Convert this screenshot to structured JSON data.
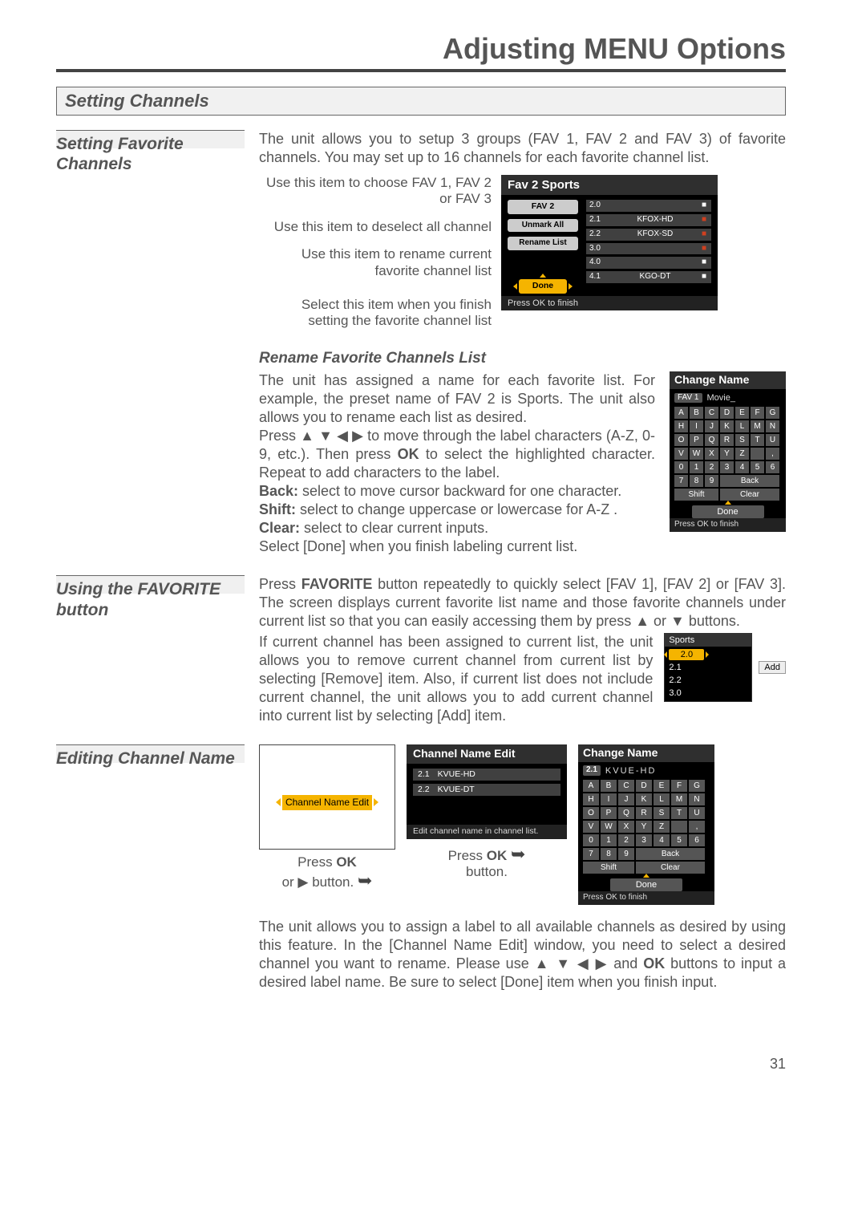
{
  "page": {
    "title": "Adjusting MENU Options",
    "number": "31"
  },
  "setting_channels": {
    "header": "Setting Channels"
  },
  "setting_favorite": {
    "side_label": "Setting Favorite Channels",
    "intro": "The unit allows you to setup 3 groups (FAV 1, FAV 2 and FAV 3) of favorite channels. You may set up to 16 channels for each favorite channel list.",
    "callouts": {
      "a": "Use this item to choose FAV 1, FAV 2 or FAV 3",
      "b": "Use this item to deselect all channel",
      "c": "Use this item to rename current favorite channel list",
      "d": "Select this item when you finish setting the favorite channel list"
    },
    "osd": {
      "title": "Fav 2 Sports",
      "buttons": {
        "fav2": "FAV 2",
        "unmark": "Unmark All",
        "rename": "Rename List",
        "done": "Done"
      },
      "channels": [
        {
          "ch": "2.0",
          "name": "",
          "flag": "■",
          "flag_red": false
        },
        {
          "ch": "2.1",
          "name": "KFOX-HD",
          "flag": "■",
          "flag_red": true
        },
        {
          "ch": "2.2",
          "name": "KFOX-SD",
          "flag": "■",
          "flag_red": true
        },
        {
          "ch": "3.0",
          "name": "",
          "flag": "■",
          "flag_red": true
        },
        {
          "ch": "4.0",
          "name": "",
          "flag": "■",
          "flag_red": false
        },
        {
          "ch": "4.1",
          "name": "KGO-DT",
          "flag": "■",
          "flag_red": false
        }
      ],
      "footer": "Press OK to finish"
    },
    "rename": {
      "subhead": "Rename Favorite Channels List",
      "p1": "The unit has assigned a name for each favorite list. For example, the preset name of FAV 2 is Sports. The unit also allows you to rename each list as desired.",
      "p2a": "Press ▲ ▼ ◀ ▶ to move through the label characters (A-Z, 0-9, etc.). Then press ",
      "p2b": "OK",
      "p2c": " to select the highlighted character. Repeat to add characters to the label.",
      "back_b": "Back:",
      "back_t": " select to move cursor backward for one character.",
      "shift_b": "Shift:",
      "shift_t": " select to change uppercase or lowercase for A-Z .",
      "clear_b": "Clear:",
      "clear_t": " select to clear current inputs.",
      "p3": "Select [Done] when you finish labeling current list."
    },
    "change_name_panel": {
      "title": "Change Name",
      "fav_label": "FAV 1",
      "current": "Movie_",
      "keys_row1": [
        "A",
        "B",
        "C",
        "D",
        "E",
        "F",
        "G"
      ],
      "keys_row2": [
        "H",
        "I",
        "J",
        "K",
        "L",
        "M",
        "N"
      ],
      "keys_row3": [
        "O",
        "P",
        "Q",
        "R",
        "S",
        "T",
        "U"
      ],
      "keys_row4": [
        "V",
        "W",
        "X",
        "Y",
        "Z",
        "",
        ","
      ],
      "keys_row5": [
        "0",
        "1",
        "2",
        "3",
        "4",
        "5",
        "6"
      ],
      "keys_row6a": [
        "7",
        "8",
        "9"
      ],
      "back": "Back",
      "shift": "Shift",
      "clear": "Clear",
      "done": "Done",
      "footer": "Press OK to finish"
    }
  },
  "favorite_button": {
    "side_label": "Using the FAVORITE button",
    "p1a": "Press ",
    "p1b": "FAVORITE",
    "p1c": " button repeatedly to quickly select [FAV 1], [FAV 2] or [FAV 3]. The screen displays current favorite list name and those favorite channels under current list so that you can easily accessing them by press ▲ or ▼ buttons.",
    "p2": "If current channel has been assigned to current list, the unit allows you to remove current channel from current list by selecting [Remove] item. Also, if current list does not include current channel, the unit allows you to add current channel into current list by selecting [Add] item.",
    "popup": {
      "title": "Sports",
      "selected": "2.0",
      "items": [
        "2.1",
        "2.2",
        "3.0"
      ],
      "add": "Add"
    }
  },
  "editing_name": {
    "side_label": "Editing Channel Name",
    "box1_item": "Channel Name Edit",
    "step1a": "Press ",
    "step1b": "OK",
    "step1c": " or ▶ button.",
    "mid_panel": {
      "title": "Channel Name Edit",
      "rows": [
        {
          "ch": "2.1",
          "name": "KVUE-HD"
        },
        {
          "ch": "2.2",
          "name": "KVUE-DT"
        }
      ],
      "footer": "Edit channel name in channel list."
    },
    "step2a": "Press ",
    "step2b": "OK",
    "step2c": " button.",
    "change_panel": {
      "title": "Change Name",
      "chan": "2.1",
      "current": "KVUE-HD",
      "keys_row1": [
        "A",
        "B",
        "C",
        "D",
        "E",
        "F",
        "G"
      ],
      "keys_row2": [
        "H",
        "I",
        "J",
        "K",
        "L",
        "M",
        "N"
      ],
      "keys_row3": [
        "O",
        "P",
        "Q",
        "R",
        "S",
        "T",
        "U"
      ],
      "keys_row4": [
        "V",
        "W",
        "X",
        "Y",
        "Z",
        "",
        ","
      ],
      "keys_row5": [
        "0",
        "1",
        "2",
        "3",
        "4",
        "5",
        "6"
      ],
      "keys_row6a": [
        "7",
        "8",
        "9"
      ],
      "back": "Back",
      "shift": "Shift",
      "clear": "Clear",
      "done": "Done",
      "footer": "Press OK to finish"
    },
    "bottom_a": "The unit allows you to assign a label to all available channels as desired by using this feature. In the [Channel Name Edit] window, you need to select a desired channel you want to rename. Please use ▲ ▼ ◀ ▶ and ",
    "bottom_b": "OK",
    "bottom_c": " buttons to input a desired label name. Be sure to select [Done] item when you finish input."
  }
}
